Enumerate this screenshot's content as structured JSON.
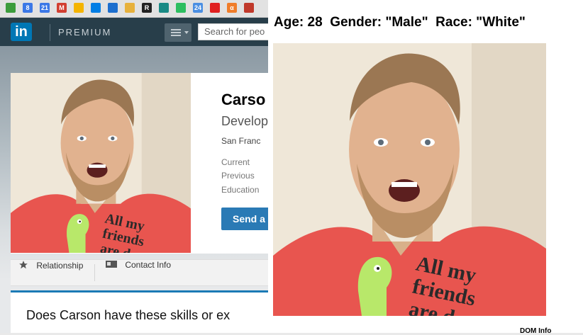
{
  "browser": {
    "bookmark_icons": [
      {
        "name": "green-arrow-bookmark",
        "color": "#3c9c3c",
        "glyph": ""
      },
      {
        "name": "google-plus-bookmark",
        "color": "#3b78e7",
        "glyph": "8"
      },
      {
        "name": "calendar-bookmark",
        "color": "#3b78e7",
        "glyph": "21"
      },
      {
        "name": "gmail-bookmark",
        "color": "#d23f31",
        "glyph": "M"
      },
      {
        "name": "drive-bookmark",
        "color": "#f4b400",
        "glyph": ""
      },
      {
        "name": "dropbox-bookmark",
        "color": "#007ee5",
        "glyph": ""
      },
      {
        "name": "cloud-bookmark",
        "color": "#1d6fce",
        "glyph": ""
      },
      {
        "name": "extension-bookmark",
        "color": "#e7b13c",
        "glyph": ""
      },
      {
        "name": "r-bookmark",
        "color": "#222222",
        "glyph": "R"
      },
      {
        "name": "teal-bookmark",
        "color": "#1a8a85",
        "glyph": ""
      },
      {
        "name": "evernote-bookmark",
        "color": "#2dbe60",
        "glyph": ""
      },
      {
        "name": "calendar-blue-bookmark",
        "color": "#4b8fe2",
        "glyph": "24"
      },
      {
        "name": "red-square-bookmark",
        "color": "#e02020",
        "glyph": ""
      },
      {
        "name": "alpha-bookmark",
        "color": "#f07d2a",
        "glyph": "α"
      },
      {
        "name": "circle-bookmark",
        "color": "#c0392b",
        "glyph": ""
      }
    ]
  },
  "linkedin": {
    "logo": "in",
    "premium_label": "PREMIUM",
    "search_placeholder": "Search for peo"
  },
  "profile": {
    "name": "Carso",
    "headline": "Develop",
    "location": "San Franc",
    "meta_labels": [
      "Current",
      "Previous",
      "Education"
    ],
    "send_button": "Send a"
  },
  "action_bar": {
    "relationship": "Relationship",
    "contact_info": "Contact Info"
  },
  "skills": {
    "question": "Does Carson have these skills or ex"
  },
  "overlay": {
    "age": "Age: 28",
    "gender": "Gender: \"Male\"",
    "race": "Race: \"White\"",
    "dom_info": "DOM Info"
  },
  "photo": {
    "shirt_text": [
      "All my",
      "friends",
      "are dead"
    ],
    "shirt_color": "#e8554f",
    "dino_color": "#b8e86a"
  }
}
